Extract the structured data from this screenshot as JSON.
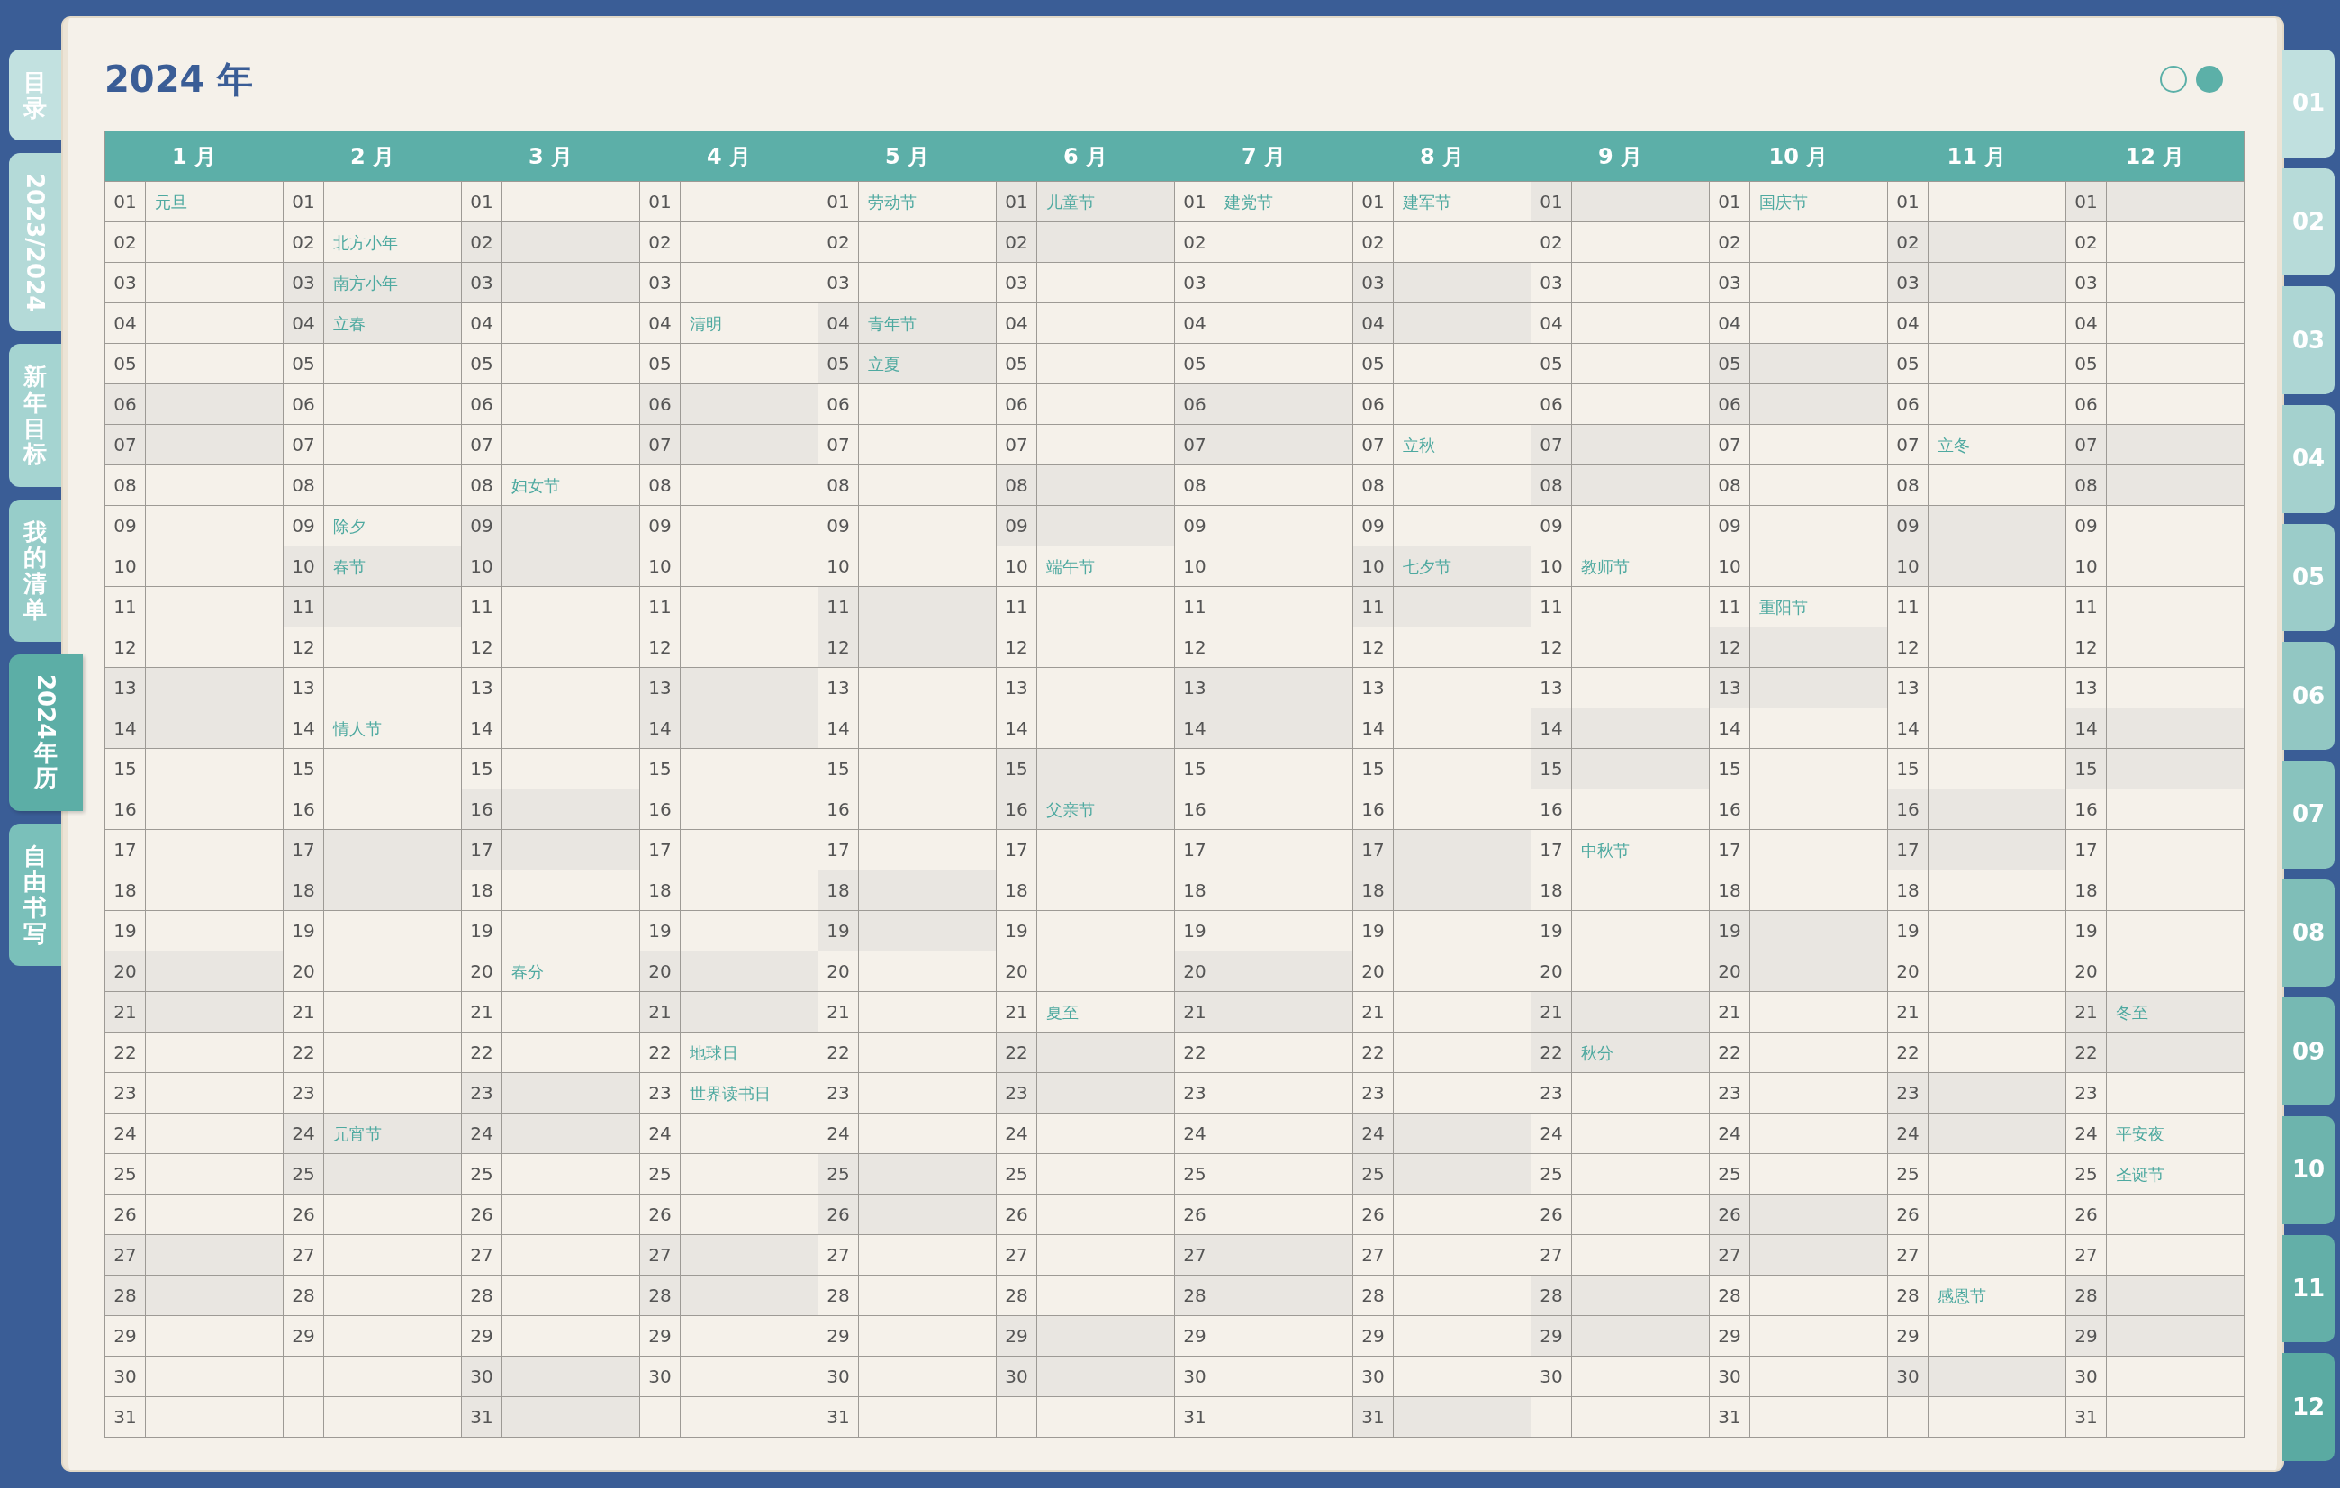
{
  "left_tabs": [
    {
      "label": "目录",
      "selected": false
    },
    {
      "label": "2023/2024",
      "selected": false
    },
    {
      "label": "新年目标",
      "selected": false
    },
    {
      "label": "我的清单",
      "selected": false
    },
    {
      "label": "2024年历",
      "selected": true
    },
    {
      "label": "自由书写",
      "selected": false
    }
  ],
  "title": "2024 年",
  "pager": [
    {
      "selected": false
    },
    {
      "selected": true
    }
  ],
  "months": [
    {
      "label": "1 月",
      "days": [
        {
          "day": "01",
          "weekend": false,
          "note": "元旦"
        },
        {
          "day": "02",
          "weekend": false
        },
        {
          "day": "03",
          "weekend": false
        },
        {
          "day": "04",
          "weekend": false
        },
        {
          "day": "05",
          "weekend": false
        },
        {
          "day": "06",
          "weekend": true
        },
        {
          "day": "07",
          "weekend": true
        },
        {
          "day": "08",
          "weekend": false
        },
        {
          "day": "09",
          "weekend": false
        },
        {
          "day": "10",
          "weekend": false
        },
        {
          "day": "11",
          "weekend": false
        },
        {
          "day": "12",
          "weekend": false
        },
        {
          "day": "13",
          "weekend": true
        },
        {
          "day": "14",
          "weekend": true
        },
        {
          "day": "15",
          "weekend": false
        },
        {
          "day": "16",
          "weekend": false
        },
        {
          "day": "17",
          "weekend": false
        },
        {
          "day": "18",
          "weekend": false
        },
        {
          "day": "19",
          "weekend": false
        },
        {
          "day": "20",
          "weekend": true
        },
        {
          "day": "21",
          "weekend": true
        },
        {
          "day": "22",
          "weekend": false
        },
        {
          "day": "23",
          "weekend": false
        },
        {
          "day": "24",
          "weekend": false
        },
        {
          "day": "25",
          "weekend": false
        },
        {
          "day": "26",
          "weekend": false
        },
        {
          "day": "27",
          "weekend": true
        },
        {
          "day": "28",
          "weekend": true
        },
        {
          "day": "29",
          "weekend": false
        },
        {
          "day": "30",
          "weekend": false
        },
        {
          "day": "31",
          "weekend": false
        }
      ]
    },
    {
      "label": "2 月",
      "days": [
        {
          "day": "01",
          "weekend": false
        },
        {
          "day": "02",
          "weekend": false,
          "note": "北方小年"
        },
        {
          "day": "03",
          "weekend": true,
          "note": "南方小年"
        },
        {
          "day": "04",
          "weekend": true,
          "note": "立春"
        },
        {
          "day": "05",
          "weekend": false
        },
        {
          "day": "06",
          "weekend": false
        },
        {
          "day": "07",
          "weekend": false
        },
        {
          "day": "08",
          "weekend": false
        },
        {
          "day": "09",
          "weekend": false,
          "note": "除夕"
        },
        {
          "day": "10",
          "weekend": true,
          "note": "春节"
        },
        {
          "day": "11",
          "weekend": true
        },
        {
          "day": "12",
          "weekend": false
        },
        {
          "day": "13",
          "weekend": false
        },
        {
          "day": "14",
          "weekend": false,
          "note": "情人节"
        },
        {
          "day": "15",
          "weekend": false
        },
        {
          "day": "16",
          "weekend": false
        },
        {
          "day": "17",
          "weekend": true
        },
        {
          "day": "18",
          "weekend": true
        },
        {
          "day": "19",
          "weekend": false
        },
        {
          "day": "20",
          "weekend": false
        },
        {
          "day": "21",
          "weekend": false
        },
        {
          "day": "22",
          "weekend": false
        },
        {
          "day": "23",
          "weekend": false
        },
        {
          "day": "24",
          "weekend": true,
          "note": "元宵节"
        },
        {
          "day": "25",
          "weekend": true
        },
        {
          "day": "26",
          "weekend": false
        },
        {
          "day": "27",
          "weekend": false
        },
        {
          "day": "28",
          "weekend": false
        },
        {
          "day": "29",
          "weekend": false
        }
      ]
    },
    {
      "label": "3 月",
      "days": [
        {
          "day": "01",
          "weekend": false
        },
        {
          "day": "02",
          "weekend": true
        },
        {
          "day": "03",
          "weekend": true
        },
        {
          "day": "04",
          "weekend": false
        },
        {
          "day": "05",
          "weekend": false
        },
        {
          "day": "06",
          "weekend": false
        },
        {
          "day": "07",
          "weekend": false
        },
        {
          "day": "08",
          "weekend": false,
          "note": "妇女节"
        },
        {
          "day": "09",
          "weekend": true
        },
        {
          "day": "10",
          "weekend": true
        },
        {
          "day": "11",
          "weekend": false
        },
        {
          "day": "12",
          "weekend": false
        },
        {
          "day": "13",
          "weekend": false
        },
        {
          "day": "14",
          "weekend": false
        },
        {
          "day": "15",
          "weekend": false
        },
        {
          "day": "16",
          "weekend": true
        },
        {
          "day": "17",
          "weekend": true
        },
        {
          "day": "18",
          "weekend": false
        },
        {
          "day": "19",
          "weekend": false
        },
        {
          "day": "20",
          "weekend": false,
          "note": "春分"
        },
        {
          "day": "21",
          "weekend": false
        },
        {
          "day": "22",
          "weekend": false
        },
        {
          "day": "23",
          "weekend": true
        },
        {
          "day": "24",
          "weekend": true
        },
        {
          "day": "25",
          "weekend": false
        },
        {
          "day": "26",
          "weekend": false
        },
        {
          "day": "27",
          "weekend": false
        },
        {
          "day": "28",
          "weekend": false
        },
        {
          "day": "29",
          "weekend": false
        },
        {
          "day": "30",
          "weekend": true
        },
        {
          "day": "31",
          "weekend": true
        }
      ]
    },
    {
      "label": "4 月",
      "days": [
        {
          "day": "01",
          "weekend": false
        },
        {
          "day": "02",
          "weekend": false
        },
        {
          "day": "03",
          "weekend": false
        },
        {
          "day": "04",
          "weekend": false,
          "note": "清明"
        },
        {
          "day": "05",
          "weekend": false
        },
        {
          "day": "06",
          "weekend": true
        },
        {
          "day": "07",
          "weekend": true
        },
        {
          "day": "08",
          "weekend": false
        },
        {
          "day": "09",
          "weekend": false
        },
        {
          "day": "10",
          "weekend": false
        },
        {
          "day": "11",
          "weekend": false
        },
        {
          "day": "12",
          "weekend": false
        },
        {
          "day": "13",
          "weekend": true
        },
        {
          "day": "14",
          "weekend": true
        },
        {
          "day": "15",
          "weekend": false
        },
        {
          "day": "16",
          "weekend": false
        },
        {
          "day": "17",
          "weekend": false
        },
        {
          "day": "18",
          "weekend": false
        },
        {
          "day": "19",
          "weekend": false
        },
        {
          "day": "20",
          "weekend": true
        },
        {
          "day": "21",
          "weekend": true
        },
        {
          "day": "22",
          "weekend": false,
          "note": "地球日"
        },
        {
          "day": "23",
          "weekend": false,
          "note": "世界读书日"
        },
        {
          "day": "24",
          "weekend": false
        },
        {
          "day": "25",
          "weekend": false
        },
        {
          "day": "26",
          "weekend": false
        },
        {
          "day": "27",
          "weekend": true
        },
        {
          "day": "28",
          "weekend": true
        },
        {
          "day": "29",
          "weekend": false
        },
        {
          "day": "30",
          "weekend": false
        }
      ]
    },
    {
      "label": "5 月",
      "days": [
        {
          "day": "01",
          "weekend": false,
          "note": "劳动节"
        },
        {
          "day": "02",
          "weekend": false
        },
        {
          "day": "03",
          "weekend": false
        },
        {
          "day": "04",
          "weekend": true,
          "note": "青年节"
        },
        {
          "day": "05",
          "weekend": true,
          "note": "立夏"
        },
        {
          "day": "06",
          "weekend": false
        },
        {
          "day": "07",
          "weekend": false
        },
        {
          "day": "08",
          "weekend": false
        },
        {
          "day": "09",
          "weekend": false
        },
        {
          "day": "10",
          "weekend": false
        },
        {
          "day": "11",
          "weekend": true
        },
        {
          "day": "12",
          "weekend": true
        },
        {
          "day": "13",
          "weekend": false
        },
        {
          "day": "14",
          "weekend": false
        },
        {
          "day": "15",
          "weekend": false
        },
        {
          "day": "16",
          "weekend": false
        },
        {
          "day": "17",
          "weekend": false
        },
        {
          "day": "18",
          "weekend": true
        },
        {
          "day": "19",
          "weekend": true
        },
        {
          "day": "20",
          "weekend": false
        },
        {
          "day": "21",
          "weekend": false
        },
        {
          "day": "22",
          "weekend": false
        },
        {
          "day": "23",
          "weekend": false
        },
        {
          "day": "24",
          "weekend": false
        },
        {
          "day": "25",
          "weekend": true
        },
        {
          "day": "26",
          "weekend": true
        },
        {
          "day": "27",
          "weekend": false
        },
        {
          "day": "28",
          "weekend": false
        },
        {
          "day": "29",
          "weekend": false
        },
        {
          "day": "30",
          "weekend": false
        },
        {
          "day": "31",
          "weekend": false
        }
      ]
    },
    {
      "label": "6 月",
      "days": [
        {
          "day": "01",
          "weekend": true,
          "note": "儿童节"
        },
        {
          "day": "02",
          "weekend": true
        },
        {
          "day": "03",
          "weekend": false
        },
        {
          "day": "04",
          "weekend": false
        },
        {
          "day": "05",
          "weekend": false
        },
        {
          "day": "06",
          "weekend": false
        },
        {
          "day": "07",
          "weekend": false
        },
        {
          "day": "08",
          "weekend": true
        },
        {
          "day": "09",
          "weekend": true
        },
        {
          "day": "10",
          "weekend": false,
          "note": "端午节"
        },
        {
          "day": "11",
          "weekend": false
        },
        {
          "day": "12",
          "weekend": false
        },
        {
          "day": "13",
          "weekend": false
        },
        {
          "day": "14",
          "weekend": false
        },
        {
          "day": "15",
          "weekend": true
        },
        {
          "day": "16",
          "weekend": true,
          "note": "父亲节"
        },
        {
          "day": "17",
          "weekend": false
        },
        {
          "day": "18",
          "weekend": false
        },
        {
          "day": "19",
          "weekend": false
        },
        {
          "day": "20",
          "weekend": false
        },
        {
          "day": "21",
          "weekend": false,
          "note": "夏至"
        },
        {
          "day": "22",
          "weekend": true
        },
        {
          "day": "23",
          "weekend": true
        },
        {
          "day": "24",
          "weekend": false
        },
        {
          "day": "25",
          "weekend": false
        },
        {
          "day": "26",
          "weekend": false
        },
        {
          "day": "27",
          "weekend": false
        },
        {
          "day": "28",
          "weekend": false
        },
        {
          "day": "29",
          "weekend": true
        },
        {
          "day": "30",
          "weekend": true
        }
      ]
    },
    {
      "label": "7 月",
      "days": [
        {
          "day": "01",
          "weekend": false,
          "note": "建党节"
        },
        {
          "day": "02",
          "weekend": false
        },
        {
          "day": "03",
          "weekend": false
        },
        {
          "day": "04",
          "weekend": false
        },
        {
          "day": "05",
          "weekend": false
        },
        {
          "day": "06",
          "weekend": true
        },
        {
          "day": "07",
          "weekend": true
        },
        {
          "day": "08",
          "weekend": false
        },
        {
          "day": "09",
          "weekend": false
        },
        {
          "day": "10",
          "weekend": false
        },
        {
          "day": "11",
          "weekend": false
        },
        {
          "day": "12",
          "weekend": false
        },
        {
          "day": "13",
          "weekend": true
        },
        {
          "day": "14",
          "weekend": true
        },
        {
          "day": "15",
          "weekend": false
        },
        {
          "day": "16",
          "weekend": false
        },
        {
          "day": "17",
          "weekend": false
        },
        {
          "day": "18",
          "weekend": false
        },
        {
          "day": "19",
          "weekend": false
        },
        {
          "day": "20",
          "weekend": true
        },
        {
          "day": "21",
          "weekend": true
        },
        {
          "day": "22",
          "weekend": false
        },
        {
          "day": "23",
          "weekend": false
        },
        {
          "day": "24",
          "weekend": false
        },
        {
          "day": "25",
          "weekend": false
        },
        {
          "day": "26",
          "weekend": false
        },
        {
          "day": "27",
          "weekend": true
        },
        {
          "day": "28",
          "weekend": true
        },
        {
          "day": "29",
          "weekend": false
        },
        {
          "day": "30",
          "weekend": false
        },
        {
          "day": "31",
          "weekend": false
        }
      ]
    },
    {
      "label": "8 月",
      "days": [
        {
          "day": "01",
          "weekend": false,
          "note": "建军节"
        },
        {
          "day": "02",
          "weekend": false
        },
        {
          "day": "03",
          "weekend": true
        },
        {
          "day": "04",
          "weekend": true
        },
        {
          "day": "05",
          "weekend": false
        },
        {
          "day": "06",
          "weekend": false
        },
        {
          "day": "07",
          "weekend": false,
          "note": "立秋"
        },
        {
          "day": "08",
          "weekend": false
        },
        {
          "day": "09",
          "weekend": false
        },
        {
          "day": "10",
          "weekend": true,
          "note": "七夕节"
        },
        {
          "day": "11",
          "weekend": true
        },
        {
          "day": "12",
          "weekend": false
        },
        {
          "day": "13",
          "weekend": false
        },
        {
          "day": "14",
          "weekend": false
        },
        {
          "day": "15",
          "weekend": false
        },
        {
          "day": "16",
          "weekend": false
        },
        {
          "day": "17",
          "weekend": true
        },
        {
          "day": "18",
          "weekend": true
        },
        {
          "day": "19",
          "weekend": false
        },
        {
          "day": "20",
          "weekend": false
        },
        {
          "day": "21",
          "weekend": false
        },
        {
          "day": "22",
          "weekend": false
        },
        {
          "day": "23",
          "weekend": false
        },
        {
          "day": "24",
          "weekend": true
        },
        {
          "day": "25",
          "weekend": true
        },
        {
          "day": "26",
          "weekend": false
        },
        {
          "day": "27",
          "weekend": false
        },
        {
          "day": "28",
          "weekend": false
        },
        {
          "day": "29",
          "weekend": false
        },
        {
          "day": "30",
          "weekend": false
        },
        {
          "day": "31",
          "weekend": true
        }
      ]
    },
    {
      "label": "9 月",
      "days": [
        {
          "day": "01",
          "weekend": true
        },
        {
          "day": "02",
          "weekend": false
        },
        {
          "day": "03",
          "weekend": false
        },
        {
          "day": "04",
          "weekend": false
        },
        {
          "day": "05",
          "weekend": false
        },
        {
          "day": "06",
          "weekend": false
        },
        {
          "day": "07",
          "weekend": true
        },
        {
          "day": "08",
          "weekend": true
        },
        {
          "day": "09",
          "weekend": false
        },
        {
          "day": "10",
          "weekend": false,
          "note": "教师节"
        },
        {
          "day": "11",
          "weekend": false
        },
        {
          "day": "12",
          "weekend": false
        },
        {
          "day": "13",
          "weekend": false
        },
        {
          "day": "14",
          "weekend": true
        },
        {
          "day": "15",
          "weekend": true
        },
        {
          "day": "16",
          "weekend": false
        },
        {
          "day": "17",
          "weekend": false,
          "note": "中秋节"
        },
        {
          "day": "18",
          "weekend": false
        },
        {
          "day": "19",
          "weekend": false
        },
        {
          "day": "20",
          "weekend": false
        },
        {
          "day": "21",
          "weekend": true
        },
        {
          "day": "22",
          "weekend": true,
          "note": "秋分"
        },
        {
          "day": "23",
          "weekend": false
        },
        {
          "day": "24",
          "weekend": false
        },
        {
          "day": "25",
          "weekend": false
        },
        {
          "day": "26",
          "weekend": false
        },
        {
          "day": "27",
          "weekend": false
        },
        {
          "day": "28",
          "weekend": true
        },
        {
          "day": "29",
          "weekend": true
        },
        {
          "day": "30",
          "weekend": false
        }
      ]
    },
    {
      "label": "10 月",
      "days": [
        {
          "day": "01",
          "weekend": false,
          "note": "国庆节"
        },
        {
          "day": "02",
          "weekend": false
        },
        {
          "day": "03",
          "weekend": false
        },
        {
          "day": "04",
          "weekend": false
        },
        {
          "day": "05",
          "weekend": true
        },
        {
          "day": "06",
          "weekend": true
        },
        {
          "day": "07",
          "weekend": false
        },
        {
          "day": "08",
          "weekend": false
        },
        {
          "day": "09",
          "weekend": false
        },
        {
          "day": "10",
          "weekend": false
        },
        {
          "day": "11",
          "weekend": false,
          "note": "重阳节"
        },
        {
          "day": "12",
          "weekend": true
        },
        {
          "day": "13",
          "weekend": true
        },
        {
          "day": "14",
          "weekend": false
        },
        {
          "day": "15",
          "weekend": false
        },
        {
          "day": "16",
          "weekend": false
        },
        {
          "day": "17",
          "weekend": false
        },
        {
          "day": "18",
          "weekend": false
        },
        {
          "day": "19",
          "weekend": true
        },
        {
          "day": "20",
          "weekend": true
        },
        {
          "day": "21",
          "weekend": false
        },
        {
          "day": "22",
          "weekend": false
        },
        {
          "day": "23",
          "weekend": false
        },
        {
          "day": "24",
          "weekend": false
        },
        {
          "day": "25",
          "weekend": false
        },
        {
          "day": "26",
          "weekend": true
        },
        {
          "day": "27",
          "weekend": true
        },
        {
          "day": "28",
          "weekend": false
        },
        {
          "day": "29",
          "weekend": false
        },
        {
          "day": "30",
          "weekend": false
        },
        {
          "day": "31",
          "weekend": false
        }
      ]
    },
    {
      "label": "11 月",
      "days": [
        {
          "day": "01",
          "weekend": false
        },
        {
          "day": "02",
          "weekend": true
        },
        {
          "day": "03",
          "weekend": true
        },
        {
          "day": "04",
          "weekend": false
        },
        {
          "day": "05",
          "weekend": false
        },
        {
          "day": "06",
          "weekend": false
        },
        {
          "day": "07",
          "weekend": false,
          "note": "立冬"
        },
        {
          "day": "08",
          "weekend": false
        },
        {
          "day": "09",
          "weekend": true
        },
        {
          "day": "10",
          "weekend": true
        },
        {
          "day": "11",
          "weekend": false
        },
        {
          "day": "12",
          "weekend": false
        },
        {
          "day": "13",
          "weekend": false
        },
        {
          "day": "14",
          "weekend": false
        },
        {
          "day": "15",
          "weekend": false
        },
        {
          "day": "16",
          "weekend": true
        },
        {
          "day": "17",
          "weekend": true
        },
        {
          "day": "18",
          "weekend": false
        },
        {
          "day": "19",
          "weekend": false
        },
        {
          "day": "20",
          "weekend": false
        },
        {
          "day": "21",
          "weekend": false
        },
        {
          "day": "22",
          "weekend": false
        },
        {
          "day": "23",
          "weekend": true
        },
        {
          "day": "24",
          "weekend": true
        },
        {
          "day": "25",
          "weekend": false
        },
        {
          "day": "26",
          "weekend": false
        },
        {
          "day": "27",
          "weekend": false
        },
        {
          "day": "28",
          "weekend": false,
          "note": "感恩节"
        },
        {
          "day": "29",
          "weekend": false
        },
        {
          "day": "30",
          "weekend": true
        }
      ]
    },
    {
      "label": "12 月",
      "days": [
        {
          "day": "01",
          "weekend": true
        },
        {
          "day": "02",
          "weekend": false
        },
        {
          "day": "03",
          "weekend": false
        },
        {
          "day": "04",
          "weekend": false
        },
        {
          "day": "05",
          "weekend": false
        },
        {
          "day": "06",
          "weekend": false
        },
        {
          "day": "07",
          "weekend": true
        },
        {
          "day": "08",
          "weekend": true
        },
        {
          "day": "09",
          "weekend": false
        },
        {
          "day": "10",
          "weekend": false
        },
        {
          "day": "11",
          "weekend": false
        },
        {
          "day": "12",
          "weekend": false
        },
        {
          "day": "13",
          "weekend": false
        },
        {
          "day": "14",
          "weekend": true
        },
        {
          "day": "15",
          "weekend": true
        },
        {
          "day": "16",
          "weekend": false
        },
        {
          "day": "17",
          "weekend": false
        },
        {
          "day": "18",
          "weekend": false
        },
        {
          "day": "19",
          "weekend": false
        },
        {
          "day": "20",
          "weekend": false
        },
        {
          "day": "21",
          "weekend": true,
          "note": "冬至"
        },
        {
          "day": "22",
          "weekend": true
        },
        {
          "day": "23",
          "weekend": false
        },
        {
          "day": "24",
          "weekend": false,
          "note": "平安夜"
        },
        {
          "day": "25",
          "weekend": false,
          "note": "圣诞节"
        },
        {
          "day": "26",
          "weekend": false
        },
        {
          "day": "27",
          "weekend": false
        },
        {
          "day": "28",
          "weekend": true
        },
        {
          "day": "29",
          "weekend": true
        },
        {
          "day": "30",
          "weekend": false
        },
        {
          "day": "31",
          "weekend": false
        }
      ]
    }
  ],
  "right_tabs": [
    {
      "label": "01"
    },
    {
      "label": "02"
    },
    {
      "label": "03"
    },
    {
      "label": "04"
    },
    {
      "label": "05"
    },
    {
      "label": "06"
    },
    {
      "label": "07"
    },
    {
      "label": "08"
    },
    {
      "label": "09"
    },
    {
      "label": "10"
    },
    {
      "label": "11"
    },
    {
      "label": "12"
    }
  ]
}
